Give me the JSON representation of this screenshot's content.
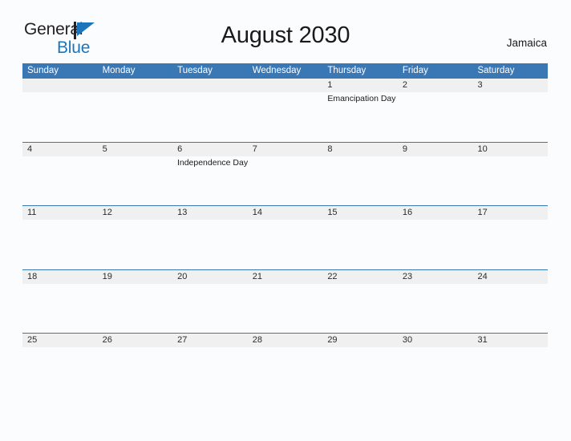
{
  "logo": {
    "line1": "General",
    "line2": "Blue",
    "flag_icon": "blue-triangle-flag-icon",
    "blue": "#1b75bb",
    "dark": "#231f20"
  },
  "header": {
    "title": "August 2030",
    "country": "Jamaica"
  },
  "calendar": {
    "accent_color": "#3a77b5",
    "date_band_color": "#f0f0f0",
    "weekdays": [
      "Sunday",
      "Monday",
      "Tuesday",
      "Wednesday",
      "Thursday",
      "Friday",
      "Saturday"
    ],
    "weeks": [
      {
        "days": [
          {
            "date": "",
            "events": []
          },
          {
            "date": "",
            "events": []
          },
          {
            "date": "",
            "events": []
          },
          {
            "date": "",
            "events": []
          },
          {
            "date": "1",
            "events": [
              "Emancipation Day"
            ]
          },
          {
            "date": "2",
            "events": []
          },
          {
            "date": "3",
            "events": []
          }
        ]
      },
      {
        "days": [
          {
            "date": "4",
            "events": []
          },
          {
            "date": "5",
            "events": []
          },
          {
            "date": "6",
            "events": [
              "Independence Day"
            ]
          },
          {
            "date": "7",
            "events": []
          },
          {
            "date": "8",
            "events": []
          },
          {
            "date": "9",
            "events": []
          },
          {
            "date": "10",
            "events": []
          }
        ]
      },
      {
        "days": [
          {
            "date": "11",
            "events": []
          },
          {
            "date": "12",
            "events": []
          },
          {
            "date": "13",
            "events": []
          },
          {
            "date": "14",
            "events": []
          },
          {
            "date": "15",
            "events": []
          },
          {
            "date": "16",
            "events": []
          },
          {
            "date": "17",
            "events": []
          }
        ]
      },
      {
        "days": [
          {
            "date": "18",
            "events": []
          },
          {
            "date": "19",
            "events": []
          },
          {
            "date": "20",
            "events": []
          },
          {
            "date": "21",
            "events": []
          },
          {
            "date": "22",
            "events": []
          },
          {
            "date": "23",
            "events": []
          },
          {
            "date": "24",
            "events": []
          }
        ]
      },
      {
        "days": [
          {
            "date": "25",
            "events": []
          },
          {
            "date": "26",
            "events": []
          },
          {
            "date": "27",
            "events": []
          },
          {
            "date": "28",
            "events": []
          },
          {
            "date": "29",
            "events": []
          },
          {
            "date": "30",
            "events": []
          },
          {
            "date": "31",
            "events": []
          }
        ]
      }
    ]
  }
}
